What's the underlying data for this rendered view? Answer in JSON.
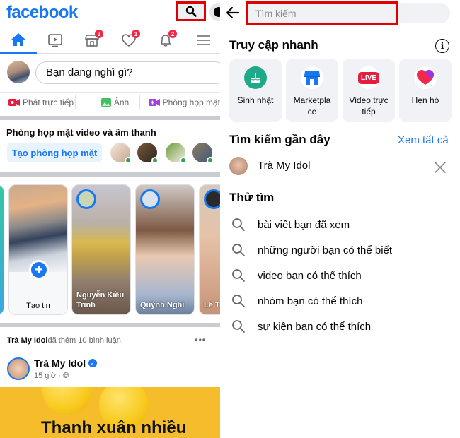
{
  "left": {
    "logo": "facebook",
    "nav": {
      "tabs": [
        {
          "name": "home",
          "icon": "home-icon",
          "active": true
        },
        {
          "name": "watch",
          "icon": "video-icon"
        },
        {
          "name": "marketplace",
          "icon": "store-icon",
          "badge": "3"
        },
        {
          "name": "dating",
          "icon": "heart-icon",
          "badge": "1"
        },
        {
          "name": "notifications",
          "icon": "bell-icon",
          "badge": "2"
        },
        {
          "name": "menu",
          "icon": "menu-icon"
        }
      ]
    },
    "composer": {
      "placeholder": "Bạn đang nghĩ gì?",
      "actions": [
        "Phát trực tiếp",
        "Ảnh",
        "Phòng họp mặt"
      ]
    },
    "rooms": {
      "title": "Phòng họp mặt video và âm thanh",
      "create_label": "Tạo phòng họp mặt"
    },
    "stories": {
      "create_label": "Tạo tin",
      "items": [
        "Nguyễn Kiều Trinh",
        "Quỳnh Nghi",
        "Lê Tr... Vũ"
      ]
    },
    "notification": {
      "actor": "Trà My Idol",
      "text": " đã thêm 10 bình luận.",
      "more": "•••"
    },
    "post": {
      "author": "Trà My Idol",
      "time": "15 giờ · ",
      "caption": "Thanh xuân nhiều"
    }
  },
  "right": {
    "search": {
      "placeholder": "Tìm kiếm",
      "value": ""
    },
    "quick_access": {
      "title": "Truy cập nhanh",
      "items": [
        {
          "label": "Sinh nhật",
          "icon": "birthday-cake-icon",
          "color": "#1fa98a"
        },
        {
          "label": "Marketplace",
          "icon": "marketplace-icon",
          "color": "#1877f2"
        },
        {
          "label": "Video trực tiếp",
          "icon": "live-icon",
          "color": "#e41e3f",
          "badge_text": "LIVE"
        },
        {
          "label": "Hẹn hò",
          "icon": "dating-heart-icon",
          "color": "#f02849"
        }
      ]
    },
    "recent": {
      "title": "Tìm kiếm gần đây",
      "see_all": "Xem tất cả",
      "items": [
        {
          "name": "Trà My Idol"
        }
      ]
    },
    "try": {
      "title": "Thử tìm",
      "items": [
        "bài viết bạn đã xem",
        "những người bạn có thể biết",
        "video bạn có thể thích",
        "nhóm bạn có thể thích",
        "sự kiện bạn có thể thích"
      ]
    }
  }
}
